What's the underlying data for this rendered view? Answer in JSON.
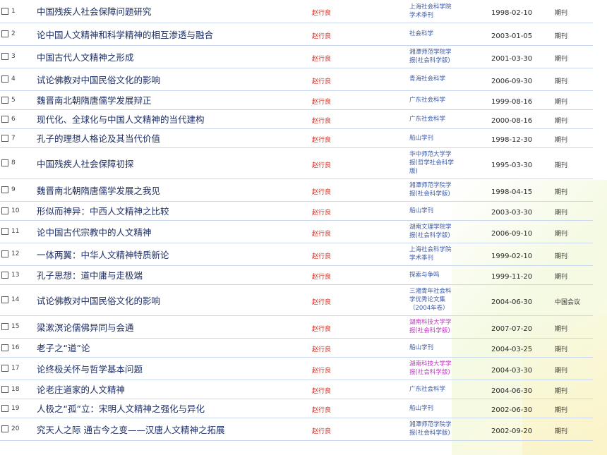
{
  "rows": [
    {
      "num": "1",
      "title": "中国残疾人社会保障问题研究",
      "author": "赵行良",
      "source": [
        "上海社会科学院",
        "学术季刊"
      ],
      "date": "1998-02-10",
      "type": "期刊"
    },
    {
      "num": "2",
      "title": "论中国人文精神和科学精神的相互渗透与融合",
      "author": "赵行良",
      "source": [
        "社会科学"
      ],
      "date": "2003-01-05",
      "type": "期刊"
    },
    {
      "num": "3",
      "title": "中国古代人文精神之形成",
      "author": "赵行良",
      "source": [
        "湘潭师范学院学",
        "报(社会科学版)"
      ],
      "date": "2001-03-30",
      "type": "期刊"
    },
    {
      "num": "4",
      "title": "试论佛教对中国民俗文化的影响",
      "author": "赵行良",
      "source": [
        "青海社会科学"
      ],
      "date": "2006-09-30",
      "type": "期刊"
    },
    {
      "num": "5",
      "title": "魏晋南北朝隋唐儒学发展辩正",
      "author": "赵行良",
      "source": [
        "广东社会科学"
      ],
      "date": "1999-08-16",
      "type": "期刊"
    },
    {
      "num": "6",
      "title": "现代化、全球化与中国人文精神的当代建构",
      "author": "赵行良",
      "source": [
        "广东社会科学"
      ],
      "date": "2000-08-16",
      "type": "期刊"
    },
    {
      "num": "7",
      "title": "孔子的理想人格论及其当代价值",
      "author": "赵行良",
      "source": [
        "船山学刊"
      ],
      "date": "1998-12-30",
      "type": "期刊"
    },
    {
      "num": "8",
      "title": "中国残疾人社会保障初探",
      "author": "赵行良",
      "source": [
        "华中师范大学学",
        "报(哲学社会科学",
        "版)"
      ],
      "date": "1995-03-30",
      "type": "期刊"
    },
    {
      "num": "9",
      "title": "魏晋南北朝隋唐儒学发展之我见",
      "author": "赵行良",
      "source": [
        "湘潭师范学院学",
        "报(社会科学版)"
      ],
      "date": "1998-04-15",
      "type": "期刊"
    },
    {
      "num": "10",
      "title": "形似而神异：中西人文精神之比较",
      "author": "赵行良",
      "source": [
        "船山学刊"
      ],
      "date": "2003-03-30",
      "type": "期刊"
    },
    {
      "num": "11",
      "title": "论中国古代宗教中的人文精神",
      "author": "赵行良",
      "source": [
        "湖南文理学院学",
        "报(社会科学版)"
      ],
      "date": "2006-09-10",
      "type": "期刊"
    },
    {
      "num": "12",
      "title": "一体两翼：中华人文精神特质新论",
      "author": "赵行良",
      "source": [
        "上海社会科学院",
        "学术季刊"
      ],
      "date": "1999-02-10",
      "type": "期刊"
    },
    {
      "num": "13",
      "title": "孔子思想：道中庸与走极端",
      "author": "赵行良",
      "source": [
        "探索与争鸣"
      ],
      "date": "1999-11-20",
      "type": "期刊"
    },
    {
      "num": "14",
      "title": "试论佛教对中国民俗文化的影响",
      "author": "赵行良",
      "source": [
        "三湘青年社会科",
        "学优秀论文集",
        "（2004年卷）"
      ],
      "date": "2004-06-30",
      "type": "中国会议"
    },
    {
      "num": "15",
      "title": "梁漱溟论儒佛异同与会通",
      "author": "赵行良",
      "source": [
        "湖南科技大学学",
        "报(社会科学版)"
      ],
      "source_magenta": true,
      "date": "2007-07-20",
      "type": "期刊"
    },
    {
      "num": "16",
      "title": "老子之“道”论",
      "author": "赵行良",
      "source": [
        "船山学刊"
      ],
      "date": "2004-03-25",
      "type": "期刊"
    },
    {
      "num": "17",
      "title": "论终极关怀与哲学基本问题",
      "author": "赵行良",
      "source": [
        "湖南科技大学学",
        "报(社会科学版)"
      ],
      "source_magenta": true,
      "date": "2004-03-30",
      "type": "期刊"
    },
    {
      "num": "18",
      "title": "论老庄道家的人文精神",
      "author": "赵行良",
      "source": [
        "广东社会科学"
      ],
      "date": "2004-06-30",
      "type": "期刊"
    },
    {
      "num": "19",
      "title": "人极之“孤”立：宋明人文精神之强化与异化",
      "author": "赵行良",
      "source": [
        "船山学刊"
      ],
      "date": "2002-06-30",
      "type": "期刊"
    },
    {
      "num": "20",
      "title": "究天人之际 通古今之变——汉唐人文精神之拓展",
      "author": "赵行良",
      "source": [
        "湘潭师范学院学",
        "报(社会科学版)"
      ],
      "date": "2002-09-20",
      "type": "期刊"
    }
  ]
}
